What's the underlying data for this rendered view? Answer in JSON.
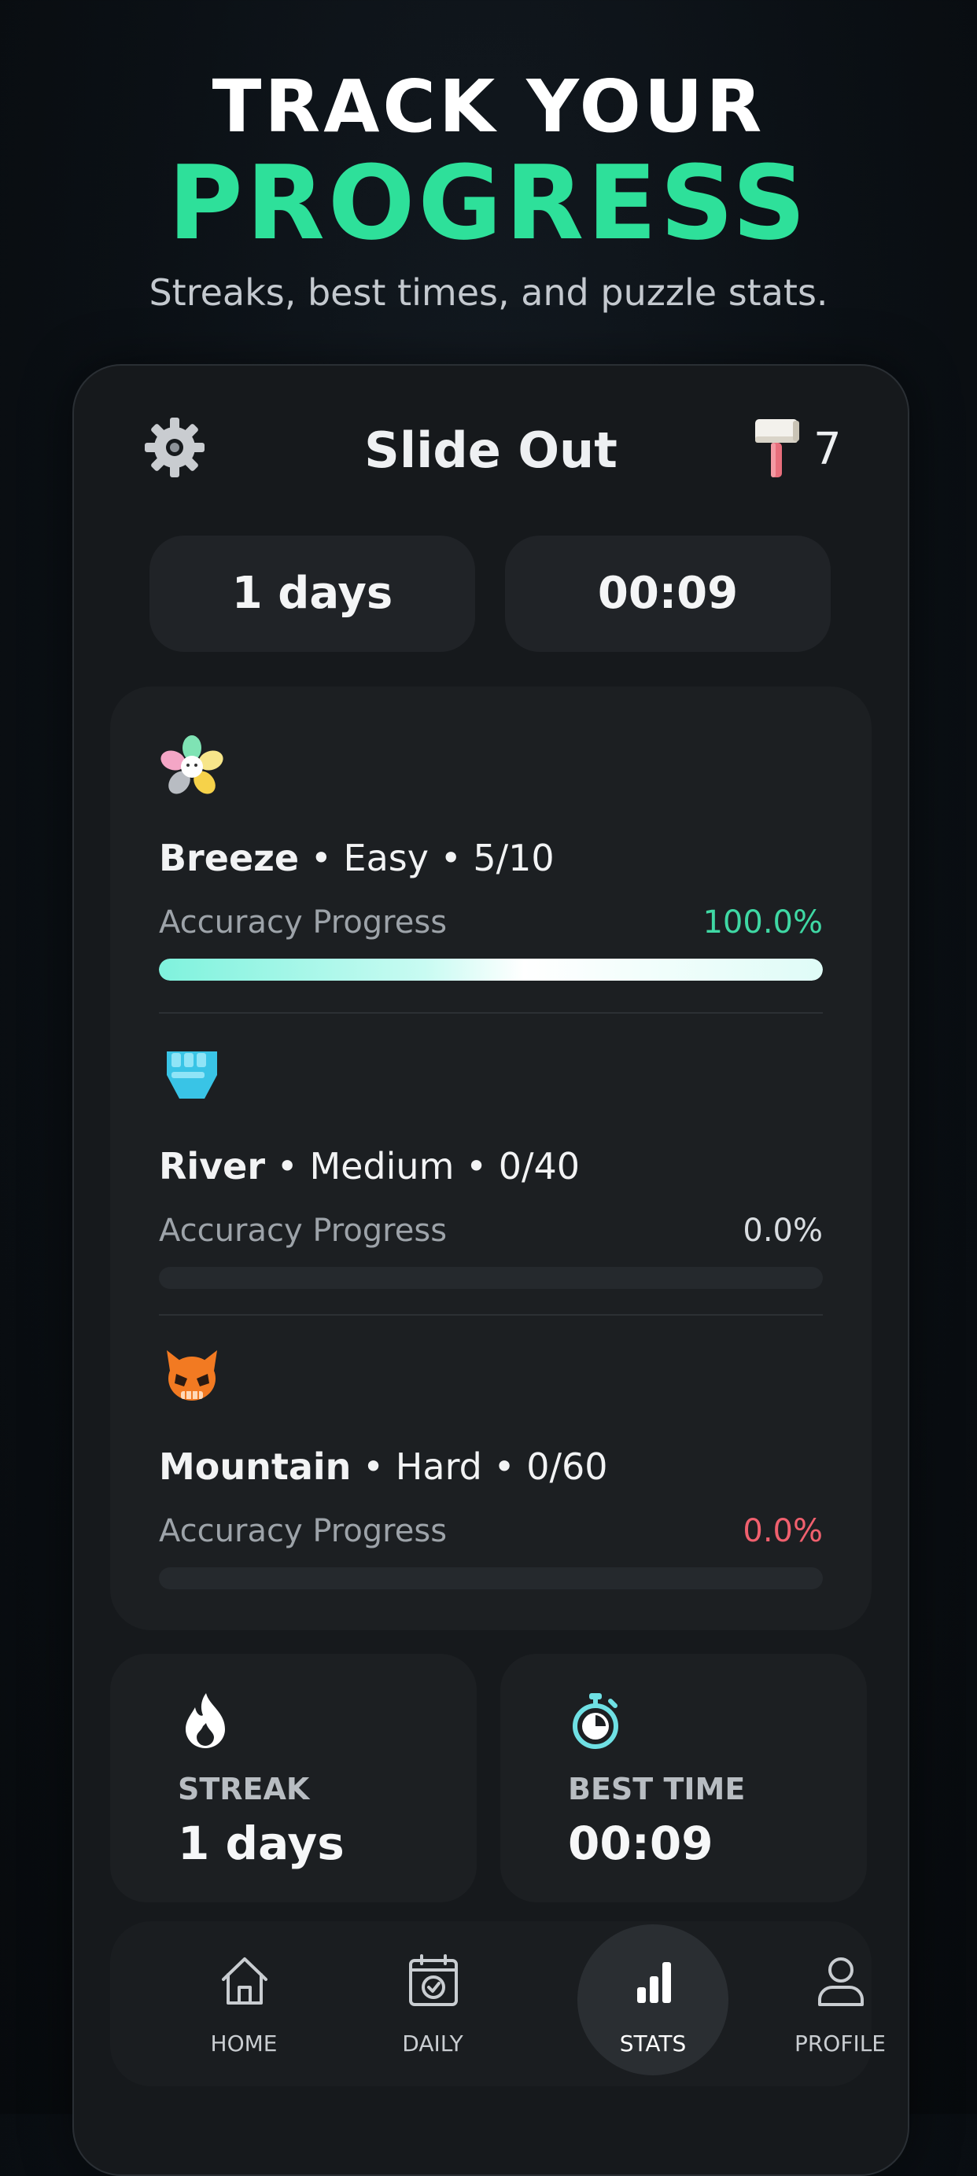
{
  "hero": {
    "line1": "TRACK YOUR",
    "line2": "PROGRESS",
    "subtitle": "Streaks, best times, and puzzle stats."
  },
  "app": {
    "title": "Slide Out",
    "hammer_count": "7",
    "settings_icon": "gear-icon",
    "hammer_icon": "hammer-icon"
  },
  "summary": {
    "streak_pill": "1 days",
    "time_pill": "00:09"
  },
  "levels": [
    {
      "name": "Breeze",
      "details": " • Easy • 5/10",
      "accuracy_label": "Accuracy Progress",
      "accuracy": "100.0%",
      "progress_fraction": 1.0,
      "accent": "#3fd8a4",
      "icon": "flower-icon"
    },
    {
      "name": "River",
      "details": " • Medium • 0/40",
      "accuracy_label": "Accuracy Progress",
      "accuracy": "0.0%",
      "progress_fraction": 0.0,
      "accent": "#d9dde1",
      "icon": "fist-icon"
    },
    {
      "name": "Mountain",
      "details": " • Hard • 0/60",
      "accuracy_label": "Accuracy Progress",
      "accuracy": "0.0%",
      "progress_fraction": 0.0,
      "accent": "#f0606e",
      "icon": "skull-icon"
    }
  ],
  "stats": {
    "streak_label": "STREAK",
    "streak_value": "1 days",
    "best_time_label": "BEST TIME",
    "best_time_value": "00:09"
  },
  "nav": {
    "items": [
      {
        "label": "HOME",
        "icon": "home-icon",
        "active": false
      },
      {
        "label": "DAILY",
        "icon": "calendar-check-icon",
        "active": false
      },
      {
        "label": "STATS",
        "icon": "bar-chart-icon",
        "active": true
      },
      {
        "label": "PROFILE",
        "icon": "user-icon",
        "active": false
      }
    ]
  },
  "colors": {
    "accent_green": "#2ee09a",
    "easy": "#3fd8a4",
    "hard": "#f0606e"
  }
}
